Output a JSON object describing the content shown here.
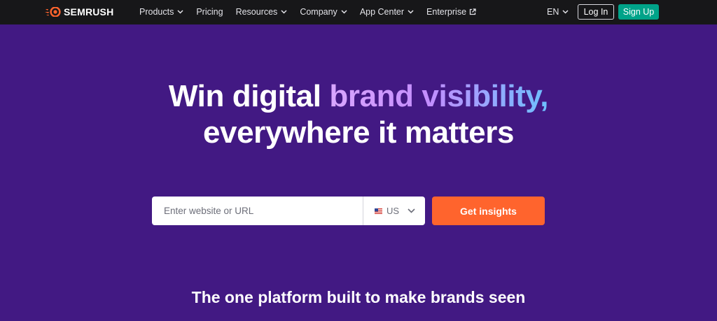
{
  "nav": {
    "brand": "SEMRUSH",
    "items": [
      {
        "label": "Products",
        "dropdown": true
      },
      {
        "label": "Pricing",
        "dropdown": false
      },
      {
        "label": "Resources",
        "dropdown": true
      },
      {
        "label": "Company",
        "dropdown": true
      },
      {
        "label": "App Center",
        "dropdown": true
      },
      {
        "label": "Enterprise",
        "external": true
      }
    ],
    "language": "EN",
    "login_label": "Log In",
    "signup_label": "Sign Up"
  },
  "hero": {
    "title_part1": "Win digital ",
    "title_highlight": "brand visibility,",
    "title_line2": "everywhere it matters"
  },
  "search": {
    "placeholder": "Enter website or URL",
    "value": "",
    "database": "US",
    "button_label": "Get insights"
  },
  "subheading": "The one platform built to make brands seen",
  "colors": {
    "nav_bg": "#171719",
    "hero_bg": "#421983",
    "accent_orange": "#ff642d",
    "signup_green": "#00a389",
    "gradient": [
      "#d9a6ff",
      "#c38dff",
      "#6dc0ff"
    ]
  },
  "icons": {
    "logo": "semrush-fire-logo-icon",
    "dropdown": "chevron-down-icon",
    "external": "external-link-icon",
    "flag": "us-flag-icon"
  }
}
